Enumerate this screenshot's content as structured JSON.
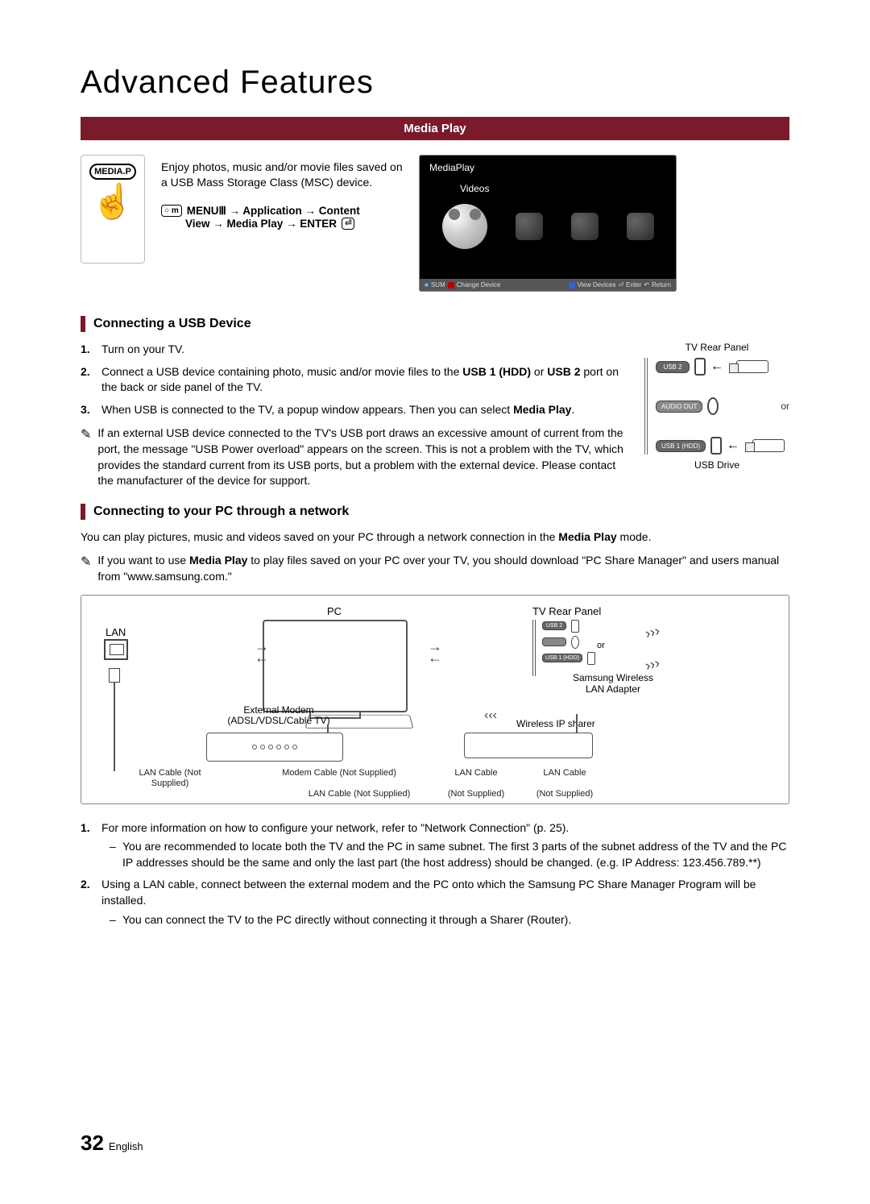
{
  "header": {
    "title": "Advanced Features"
  },
  "banner": "Media Play",
  "intro": {
    "badge": "MEDIA.P",
    "description": "Enjoy photos, music and/or movie files saved on a USB Mass Storage Class (MSC) device.",
    "menu_prefix": "MENU",
    "menu_path1": " → Application → Content",
    "menu_path2_pre": "View → Media Play → ENTER"
  },
  "tvPreview": {
    "title": "MediaPlay",
    "subtitle": "Videos",
    "footer_left_sum": "SUM",
    "footer_left_change": "Change Device",
    "footer_view": "View Devices",
    "footer_enter": "Enter",
    "footer_return": "Return"
  },
  "usbSection": {
    "heading": "Connecting a USB Device",
    "steps": [
      "Turn on your TV.",
      "Connect a USB device containing photo, music and/or movie files to the USB 1 (HDD) or USB 2 port on the back or side panel of the TV.",
      "When USB is connected to the TV, a popup window appears. Then you can select Media Play."
    ],
    "note": "If an external USB device connected to the TV's USB port draws an excessive amount of current from the port, the message \"USB Power overload\" appears on the screen. This is not a problem with the TV, which provides the standard current from its USB ports, but a problem with the external device. Please contact the manufacturer of the device for support.",
    "panel": {
      "title": "TV Rear Panel",
      "port_usb2": "USB 2",
      "port_audio": "AUDIO OUT",
      "port_usb1": "USB 1 (HDD)",
      "or": "or",
      "drive": "USB Drive"
    }
  },
  "netSection": {
    "heading": "Connecting to your PC through a network",
    "desc_pre": "You can play pictures, music and videos saved on your PC through a network connection in the ",
    "desc_bold": "Media Play",
    "desc_post": " mode.",
    "note_pre": "If you want to use ",
    "note_bold": "Media Play",
    "note_post": " to play files saved on your PC over your TV, you should download \"PC Share Manager\" and users manual from \"www.samsung.com.\"",
    "diagram": {
      "lan": "LAN",
      "pc": "PC",
      "tvpanel": "TV Rear Panel",
      "usb2": "USB 2",
      "usb1": "USB 1 (HDD)",
      "or": "or",
      "swla": "Samsung Wireless LAN Adapter",
      "modem_l1": "External Modem",
      "modem_l2": "(ADSL/VDSL/Cable TV)",
      "router": "Wireless IP sharer",
      "c1": "LAN Cable (Not Supplied)",
      "c2": "Modem Cable (Not Supplied)",
      "c3": "LAN Cable (Not Supplied)",
      "c4": "LAN Cable",
      "c4b": "(Not Supplied)",
      "c5": "LAN Cable",
      "c5b": "(Not Supplied)"
    },
    "after_steps": [
      {
        "text": "For more information on how to configure your network, refer to \"Network Connection\" (p. 25).",
        "subs": [
          "You are recommended to locate both the TV and the PC in same subnet. The first 3 parts of the subnet address of the TV and the PC IP addresses should be the same and only the last part (the host address) should be changed. (e.g. IP Address: 123.456.789.**)"
        ]
      },
      {
        "text": "Using a LAN cable, connect between the external modem and the PC onto which the Samsung PC Share Manager Program will be installed.",
        "subs": [
          "You can connect the TV to the PC directly without connecting it through a Sharer (Router)."
        ]
      }
    ]
  },
  "footer": {
    "page": "32",
    "lang": "English"
  }
}
